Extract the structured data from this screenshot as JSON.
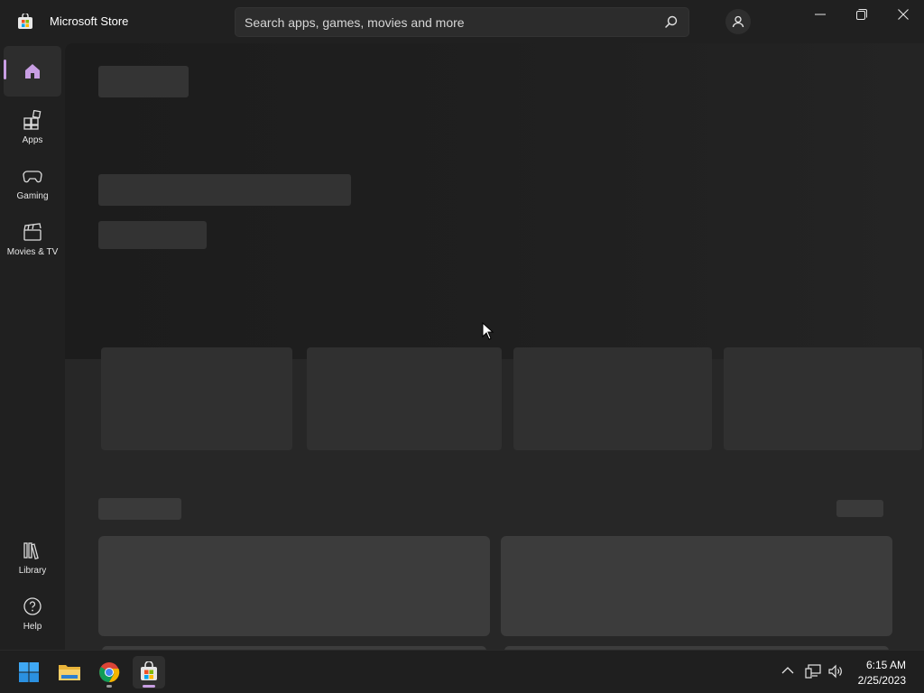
{
  "window": {
    "title": "Microsoft Store",
    "controls": {
      "minimize": "minimize",
      "restore": "restore",
      "close": "close"
    }
  },
  "search": {
    "placeholder": "Search apps, games, movies and more"
  },
  "nav": {
    "items": [
      {
        "id": "home",
        "label": "",
        "icon": "home-icon",
        "active": true
      },
      {
        "id": "apps",
        "label": "Apps",
        "icon": "apps-grid-icon"
      },
      {
        "id": "gaming",
        "label": "Gaming",
        "icon": "gamepad-icon"
      },
      {
        "id": "movies",
        "label": "Movies & TV",
        "icon": "clapperboard-icon"
      }
    ],
    "bottom": [
      {
        "id": "library",
        "label": "Library",
        "icon": "library-icon"
      },
      {
        "id": "help",
        "label": "Help",
        "icon": "help-icon"
      }
    ]
  },
  "taskbar": {
    "apps": [
      "start",
      "file-explorer",
      "chrome",
      "microsoft-store"
    ],
    "time": "6:15 AM",
    "date": "2/25/2023"
  },
  "colors": {
    "accent": "#c89ee3",
    "background": "#202020",
    "content": "#272727"
  }
}
